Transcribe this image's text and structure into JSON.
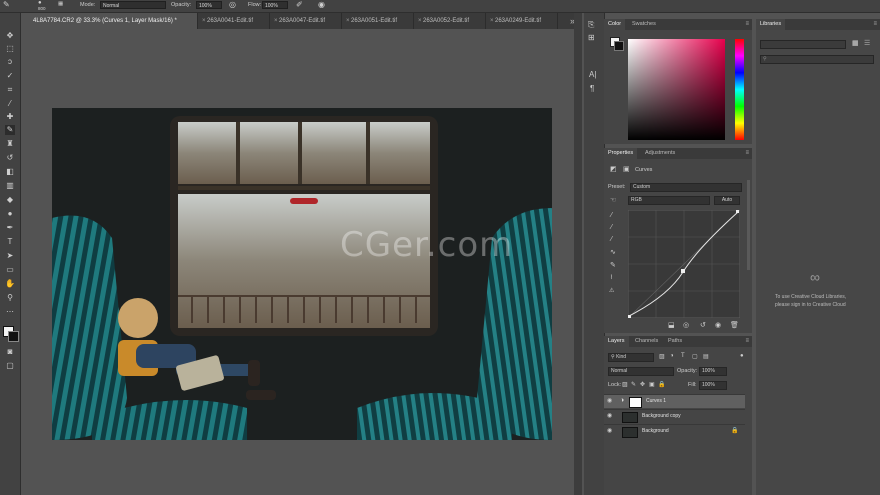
{
  "options_bar": {
    "brush_size": "800",
    "mode_label": "Mode:",
    "mode_value": "Normal",
    "opacity_label": "Opacity:",
    "opacity_value": "100%",
    "flow_label": "Flow:",
    "flow_value": "100%"
  },
  "tabs": [
    {
      "label": "4L8A7784.CR2 @ 33.3% (Curves 1, Layer Mask/16) *",
      "active": true
    },
    {
      "label": "263A0041-Edit.tif",
      "active": false
    },
    {
      "label": "263A0047-Edit.tif",
      "active": false
    },
    {
      "label": "263A0051-Edit.tif",
      "active": false
    },
    {
      "label": "263A0052-Edit.tif",
      "active": false
    },
    {
      "label": "263A0249-Edit.tif",
      "active": false
    }
  ],
  "tab_overflow": "»",
  "watermark": "CGer.com",
  "color_panel": {
    "tab_color": "Color",
    "tab_swatches": "Swatches"
  },
  "properties_panel": {
    "tab_properties": "Properties",
    "tab_adjustments": "Adjustments",
    "title": "Curves",
    "preset_label": "Preset:",
    "preset_value": "Custom",
    "channel_value": "RGB",
    "auto_label": "Auto"
  },
  "layers_panel": {
    "tab_layers": "Layers",
    "tab_channels": "Channels",
    "tab_paths": "Paths",
    "kind_value": "Kind",
    "blend_value": "Normal",
    "opacity_label": "Opacity:",
    "opacity_value": "100%",
    "lock_label": "Lock:",
    "fill_label": "Fill:",
    "fill_value": "100%",
    "layers": [
      {
        "name": "Curves 1",
        "selected": true
      },
      {
        "name": "Background copy",
        "selected": false
      },
      {
        "name": "Background",
        "selected": false
      }
    ]
  },
  "libraries_panel": {
    "tab_libraries": "Libraries",
    "message_line1": "To use Creative Cloud Libraries,",
    "message_line2": "please sign in to Creative Cloud"
  },
  "colors": {
    "ui_dark": "#424242",
    "canvas": "#535353",
    "accent_seat": "#1b6f72"
  }
}
